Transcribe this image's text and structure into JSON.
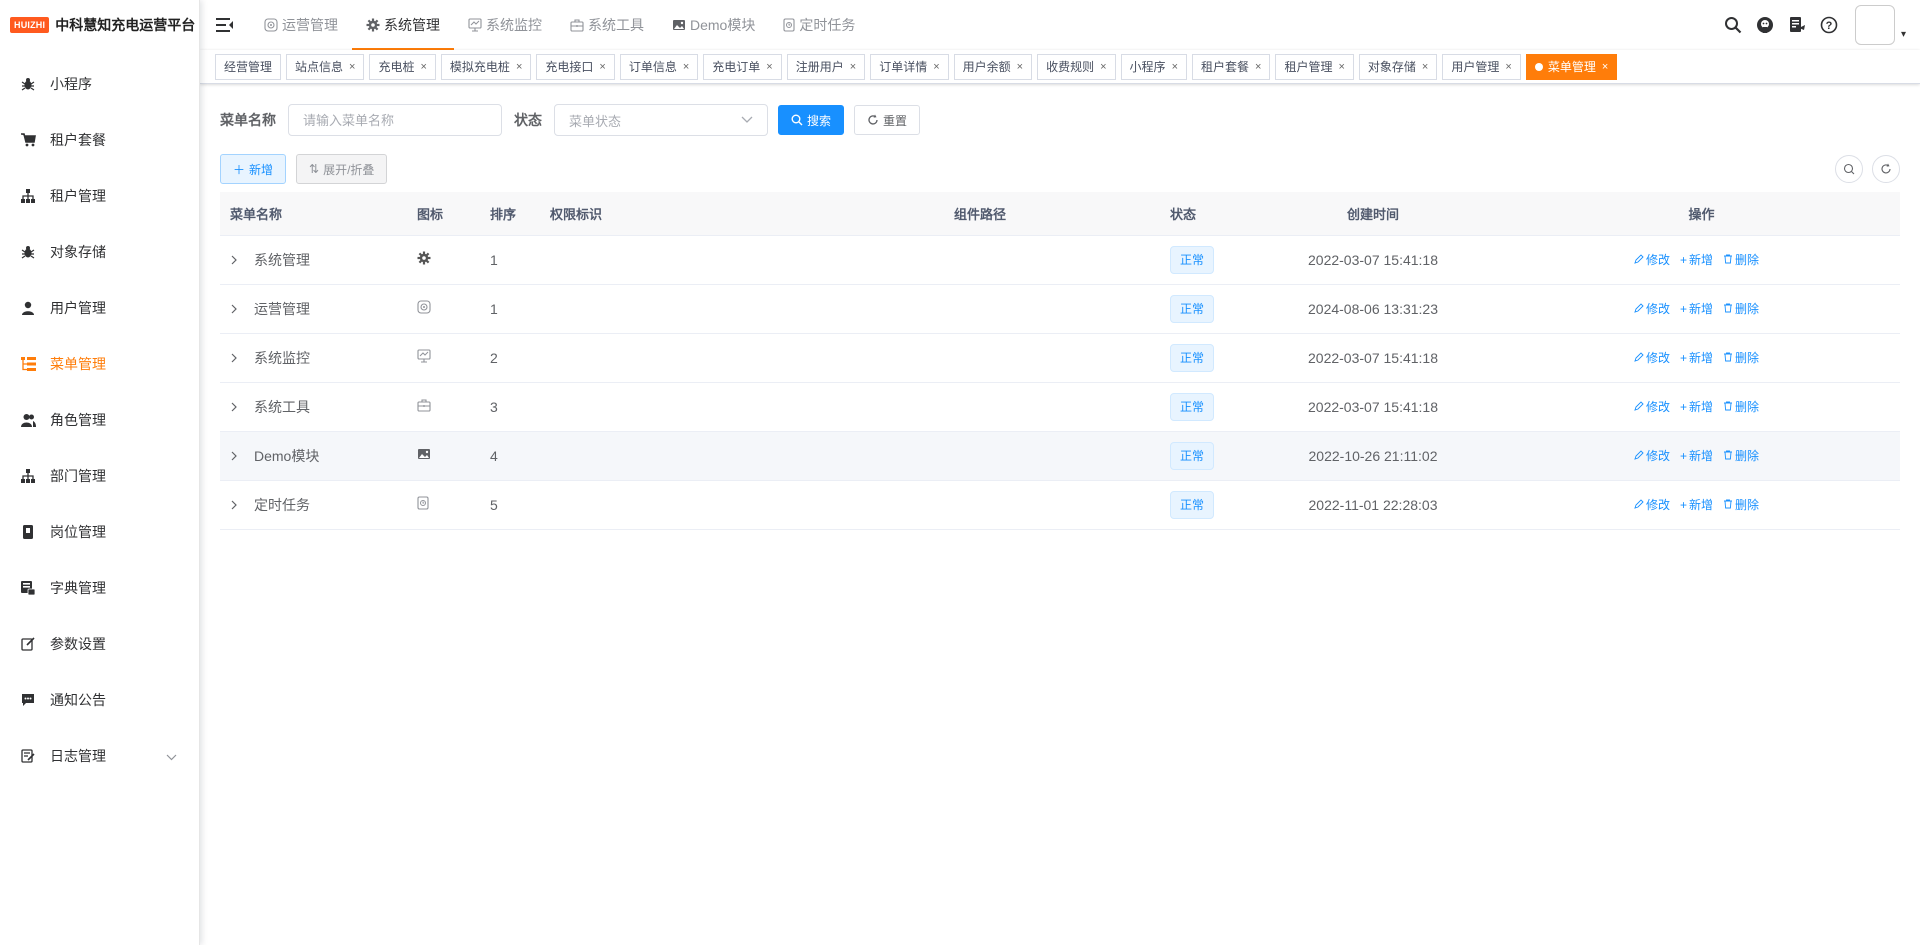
{
  "app": {
    "logo_badge": "HUIZHI",
    "title": "中科慧知充电运营平台"
  },
  "sidebar": {
    "items": [
      {
        "label": "小程序",
        "icon": "bug-icon",
        "active": false
      },
      {
        "label": "租户套餐",
        "icon": "cart-icon",
        "active": false
      },
      {
        "label": "租户管理",
        "icon": "tree-icon",
        "active": false
      },
      {
        "label": "对象存储",
        "icon": "bug-icon",
        "active": false
      },
      {
        "label": "用户管理",
        "icon": "user-icon",
        "active": false
      },
      {
        "label": "菜单管理",
        "icon": "tree-table-icon",
        "active": true
      },
      {
        "label": "角色管理",
        "icon": "peoples-icon",
        "active": false
      },
      {
        "label": "部门管理",
        "icon": "tree-icon",
        "active": false
      },
      {
        "label": "岗位管理",
        "icon": "post-icon",
        "active": false
      },
      {
        "label": "字典管理",
        "icon": "dict-icon",
        "active": false
      },
      {
        "label": "参数设置",
        "icon": "edit-icon",
        "active": false
      },
      {
        "label": "通知公告",
        "icon": "message-icon",
        "active": false
      },
      {
        "label": "日志管理",
        "icon": "log-icon",
        "active": false
      }
    ]
  },
  "topnav": {
    "items": [
      {
        "label": "运营管理",
        "icon": "operation-icon",
        "active": false
      },
      {
        "label": "系统管理",
        "icon": "gear-icon",
        "active": true
      },
      {
        "label": "系统监控",
        "icon": "monitor-icon",
        "active": false
      },
      {
        "label": "系统工具",
        "icon": "toolbox-icon",
        "active": false
      },
      {
        "label": "Demo模块",
        "icon": "image-icon",
        "active": false
      },
      {
        "label": "定时任务",
        "icon": "job-icon",
        "active": false
      }
    ]
  },
  "tags": [
    {
      "label": "经营管理",
      "closable": false
    },
    {
      "label": "站点信息",
      "closable": true
    },
    {
      "label": "充电桩",
      "closable": true
    },
    {
      "label": "模拟充电桩",
      "closable": true
    },
    {
      "label": "充电接口",
      "closable": true
    },
    {
      "label": "订单信息",
      "closable": true
    },
    {
      "label": "充电订单",
      "closable": true
    },
    {
      "label": "注册用户",
      "closable": true
    },
    {
      "label": "订单详情",
      "closable": true
    },
    {
      "label": "用户余额",
      "closable": true
    },
    {
      "label": "收费规则",
      "closable": true
    },
    {
      "label": "小程序",
      "closable": true
    },
    {
      "label": "租户套餐",
      "closable": true
    },
    {
      "label": "租户管理",
      "closable": true
    },
    {
      "label": "对象存储",
      "closable": true
    },
    {
      "label": "用户管理",
      "closable": true
    },
    {
      "label": "菜单管理",
      "closable": true,
      "active": true
    }
  ],
  "search": {
    "menu_name_label": "菜单名称",
    "menu_name_placeholder": "请输入菜单名称",
    "status_label": "状态",
    "status_placeholder": "菜单状态",
    "search_button": "搜索",
    "reset_button": "重置"
  },
  "toolbar": {
    "add_button": "新增",
    "expand_button": "展开/折叠"
  },
  "table": {
    "headers": {
      "name": "菜单名称",
      "icon": "图标",
      "order": "排序",
      "perms": "权限标识",
      "component": "组件路径",
      "status": "状态",
      "create_time": "创建时间",
      "ops": "操作"
    },
    "rows": [
      {
        "name": "系统管理",
        "icon": "gear-icon",
        "order": "1",
        "perms": "",
        "component": "",
        "status": "正常",
        "create_time": "2022-03-07 15:41:18"
      },
      {
        "name": "运营管理",
        "icon": "operation-icon",
        "order": "1",
        "perms": "",
        "component": "",
        "status": "正常",
        "create_time": "2024-08-06 13:31:23"
      },
      {
        "name": "系统监控",
        "icon": "monitor-icon",
        "order": "2",
        "perms": "",
        "component": "",
        "status": "正常",
        "create_time": "2022-03-07 15:41:18"
      },
      {
        "name": "系统工具",
        "icon": "toolbox-icon",
        "order": "3",
        "perms": "",
        "component": "",
        "status": "正常",
        "create_time": "2022-03-07 15:41:18"
      },
      {
        "name": "Demo模块",
        "icon": "image-icon",
        "order": "4",
        "perms": "",
        "component": "",
        "status": "正常",
        "create_time": "2022-10-26 21:11:02"
      },
      {
        "name": "定时任务",
        "icon": "job-icon",
        "order": "5",
        "perms": "",
        "component": "",
        "status": "正常",
        "create_time": "2022-11-01 22:28:03"
      }
    ],
    "ops": {
      "edit": "修改",
      "add": "新增",
      "delete": "删除"
    }
  },
  "colors": {
    "accent": "#ff7d0a",
    "primary": "#1890ff",
    "logo": "#ff5a1f"
  }
}
